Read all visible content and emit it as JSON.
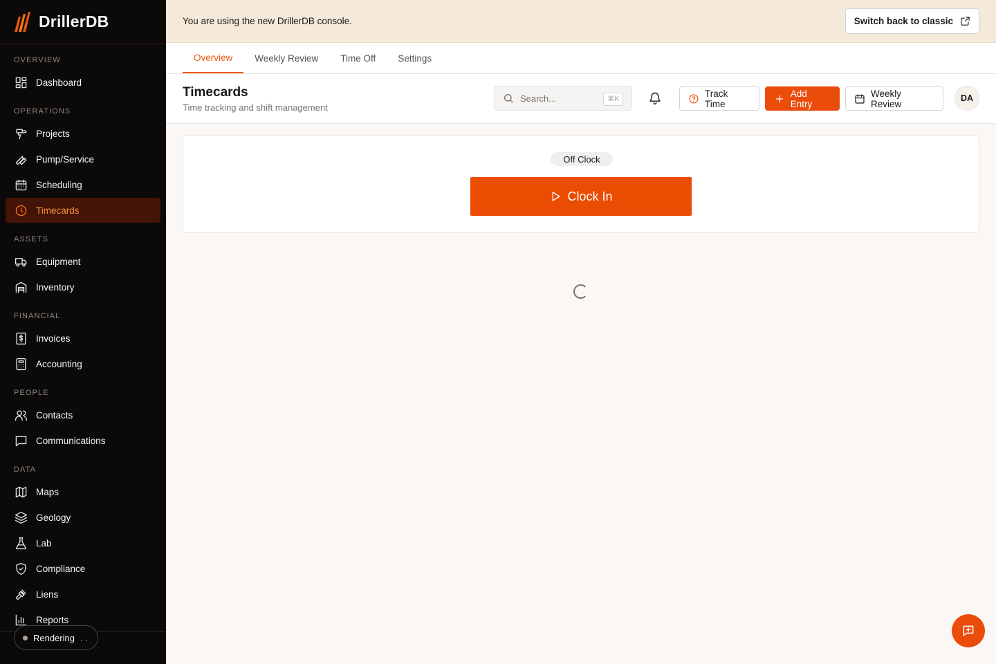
{
  "app": {
    "name": "DrillerDB"
  },
  "banner": {
    "text": "You are using the new DrillerDB console.",
    "classic_label": "Switch back to classic"
  },
  "sidebar": {
    "sections": {
      "overview": "OVERVIEW",
      "operations": "OPERATIONS",
      "assets": "ASSETS",
      "financial": "FINANCIAL",
      "people": "PEOPLE",
      "data": "DATA"
    },
    "items": {
      "dashboard": "Dashboard",
      "projects": "Projects",
      "pump_service": "Pump/Service",
      "scheduling": "Scheduling",
      "timecards": "Timecards",
      "equipment": "Equipment",
      "inventory": "Inventory",
      "invoices": "Invoices",
      "accounting": "Accounting",
      "contacts": "Contacts",
      "communications": "Communications",
      "maps": "Maps",
      "geology": "Geology",
      "lab": "Lab",
      "compliance": "Compliance",
      "liens": "Liens",
      "reports": "Reports"
    },
    "active_item": "timecards",
    "render_status": "Rendering",
    "render_dots": ". ."
  },
  "tabs": [
    {
      "label": "Overview",
      "active": true
    },
    {
      "label": "Weekly Review",
      "active": false
    },
    {
      "label": "Time Off",
      "active": false
    },
    {
      "label": "Settings",
      "active": false
    }
  ],
  "header": {
    "title": "Timecards",
    "subtitle": "Time tracking and shift management",
    "search_placeholder": "Search...",
    "search_shortcut": "⌘K",
    "track_time_label": "Track Time",
    "add_entry_label": "Add Entry",
    "weekly_review_label": "Weekly Review",
    "avatar_initials": "DA"
  },
  "clock": {
    "status": "Off Clock",
    "button_label": "Clock In"
  },
  "colors": {
    "accent": "#ea4c0c",
    "sidebar_bg": "#0c0a09",
    "banner_bg": "#f5e9da",
    "active_nav_bg": "#431407"
  },
  "icons": {
    "dashboard": "layout-grid-icon",
    "projects": "drill-icon",
    "pump_service": "wrench-icon",
    "scheduling": "calendar-icon",
    "timecards": "clock-icon",
    "equipment": "truck-icon",
    "inventory": "warehouse-icon",
    "invoices": "dollar-receipt-icon",
    "accounting": "calculator-icon",
    "contacts": "users-icon",
    "communications": "message-square-icon",
    "maps": "map-icon",
    "geology": "layers-icon",
    "lab": "flask-icon",
    "compliance": "shield-check-icon",
    "liens": "gavel-icon",
    "reports": "bar-chart-icon"
  }
}
